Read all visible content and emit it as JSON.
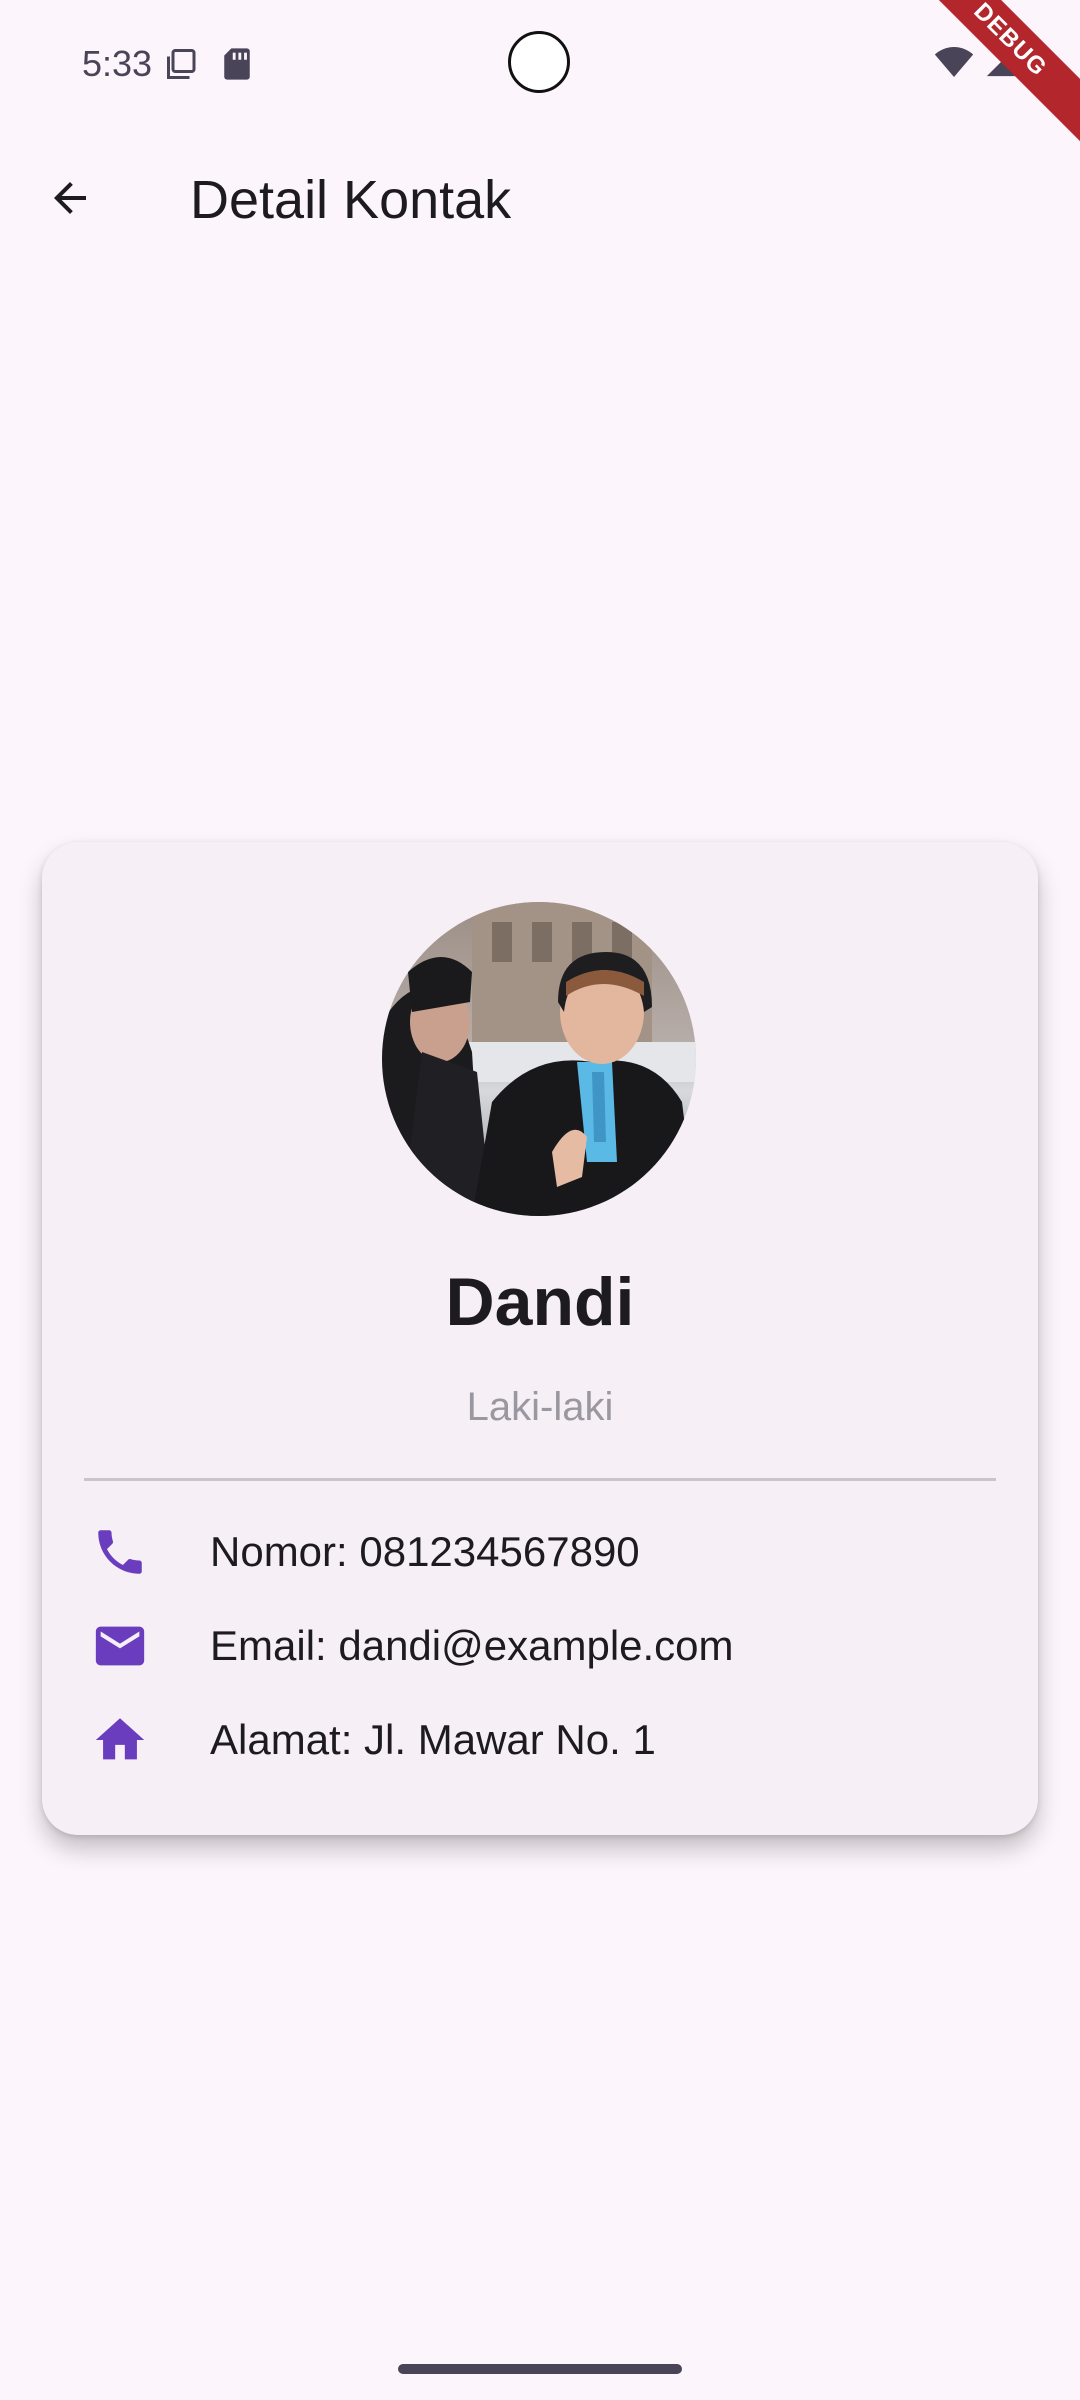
{
  "status_bar": {
    "time": "5:33",
    "debug_label": "DEBUG"
  },
  "app_bar": {
    "title": "Detail Kontak",
    "back_icon": "arrow-back-icon"
  },
  "contact": {
    "name": "Dandi",
    "gender": "Laki-laki",
    "avatar_description": "photo-avatar",
    "details": [
      {
        "icon": "phone-icon",
        "text": "Nomor: 081234567890"
      },
      {
        "icon": "email-icon",
        "text": "Email: dandi@example.com"
      },
      {
        "icon": "home-icon",
        "text": "Alamat: Jl. Mawar No. 1"
      }
    ]
  },
  "colors": {
    "background": "#FCF5FB",
    "card": "#F6EFF6",
    "accent": "#6A3DBE",
    "text": "#1D1B20",
    "muted": "#9A97A0",
    "debug_banner": "#B3262B"
  }
}
